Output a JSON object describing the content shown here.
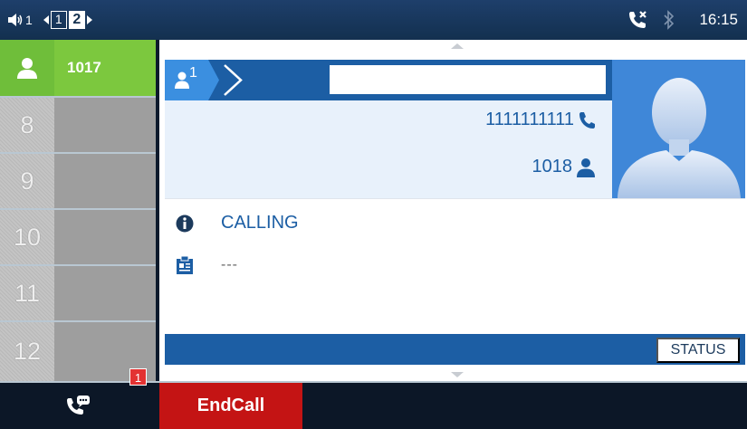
{
  "status_bar": {
    "volume_line": "1",
    "pages": [
      "1",
      "2"
    ],
    "active_page": "2",
    "time": "16:15",
    "icons": [
      "volume-icon",
      "missed-call-icon",
      "bluetooth-icon"
    ]
  },
  "sidebar": {
    "items": [
      {
        "num": "",
        "label": "1017",
        "active": true
      },
      {
        "num": "8",
        "label": ""
      },
      {
        "num": "9",
        "label": ""
      },
      {
        "num": "10",
        "label": ""
      },
      {
        "num": "11",
        "label": ""
      },
      {
        "num": "12",
        "label": ""
      }
    ]
  },
  "call": {
    "line_index": "1",
    "name": "",
    "number": "1111111111",
    "account": "1018",
    "state": "CALLING",
    "note": "---"
  },
  "softkeys": {
    "status": "STATUS"
  },
  "bottom": {
    "badge": "1",
    "end_call": "EndCall"
  },
  "colors": {
    "accent_blue": "#1c5ea4",
    "active_green": "#7cc83e",
    "end_red": "#c41414"
  }
}
